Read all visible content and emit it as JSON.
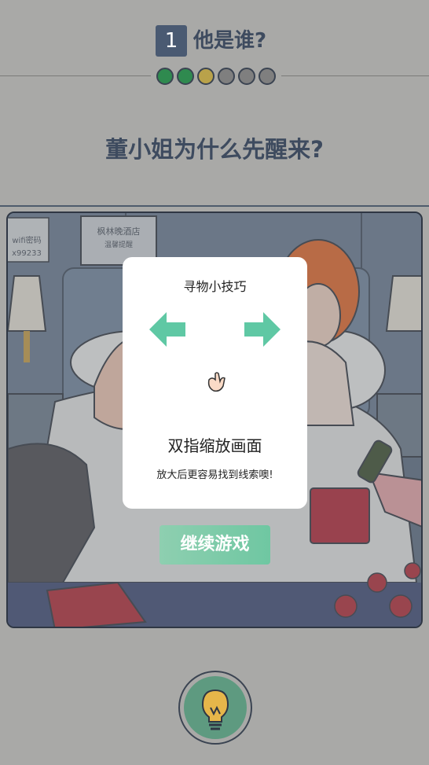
{
  "header": {
    "level_number": "1",
    "level_title": "他是谁?",
    "progress": [
      {
        "state": "done",
        "color": "#2f8a4f"
      },
      {
        "state": "done",
        "color": "#2f8a4f"
      },
      {
        "state": "current",
        "color": "#b9a24a"
      },
      {
        "state": "todo",
        "color": "#7f7f7f"
      },
      {
        "state": "todo",
        "color": "#7f7f7f"
      },
      {
        "state": "todo",
        "color": "#7f7f7f"
      }
    ]
  },
  "question": "董小姐为什么先醒来?",
  "scene": {
    "hotel_sign": "枫林晚酒店",
    "hotel_sign_sub": "温馨提醒",
    "wifi_label": "wifi密码",
    "wifi_code": "x99233"
  },
  "modal": {
    "title": "寻物小技巧",
    "left_icon": "arrow-left-icon",
    "right_icon": "arrow-right-icon",
    "hand_icon": "pinch-hand-icon",
    "heading": "双指缩放画面",
    "text": "放大后更容易找到线索噢!"
  },
  "continue_button": "继续游戏",
  "hint_button": {
    "icon": "lightbulb-icon"
  },
  "colors": {
    "accent": "#6fc7a2",
    "text_dark": "#3e4b5f",
    "overlay": "#a9a9a7"
  }
}
